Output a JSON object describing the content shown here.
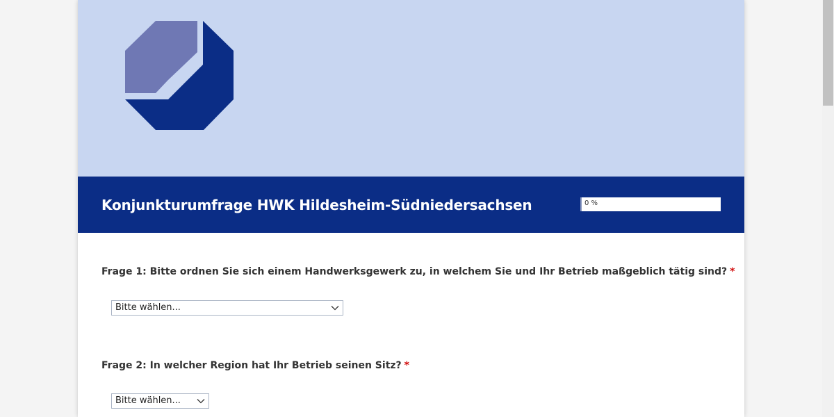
{
  "header": {
    "logo_icon": "hwk-logo-icon",
    "survey_title": "Konjunkturumfrage HWK Hildesheim-Südniedersachsen",
    "progress": {
      "label": "0 %",
      "fraction": 0.0
    }
  },
  "questions": [
    {
      "label": "Frage 1: Bitte ordnen Sie sich einem Handwerksgewerk zu, in welchem Sie und Ihr Betrieb maßgeblich tätig sind?",
      "required_mark": "*",
      "selected": "Bitte wählen..."
    },
    {
      "label": "Frage 2: In welcher Region hat Ihr Betrieb seinen Sitz?",
      "required_mark": "*",
      "selected": "Bitte wählen..."
    }
  ],
  "colors": {
    "banner": "#c8d6f1",
    "title_bar": "#0b2d86",
    "logo_light": "#6f78b4",
    "logo_dark": "#0b2d86",
    "required": "#d10a0a"
  }
}
